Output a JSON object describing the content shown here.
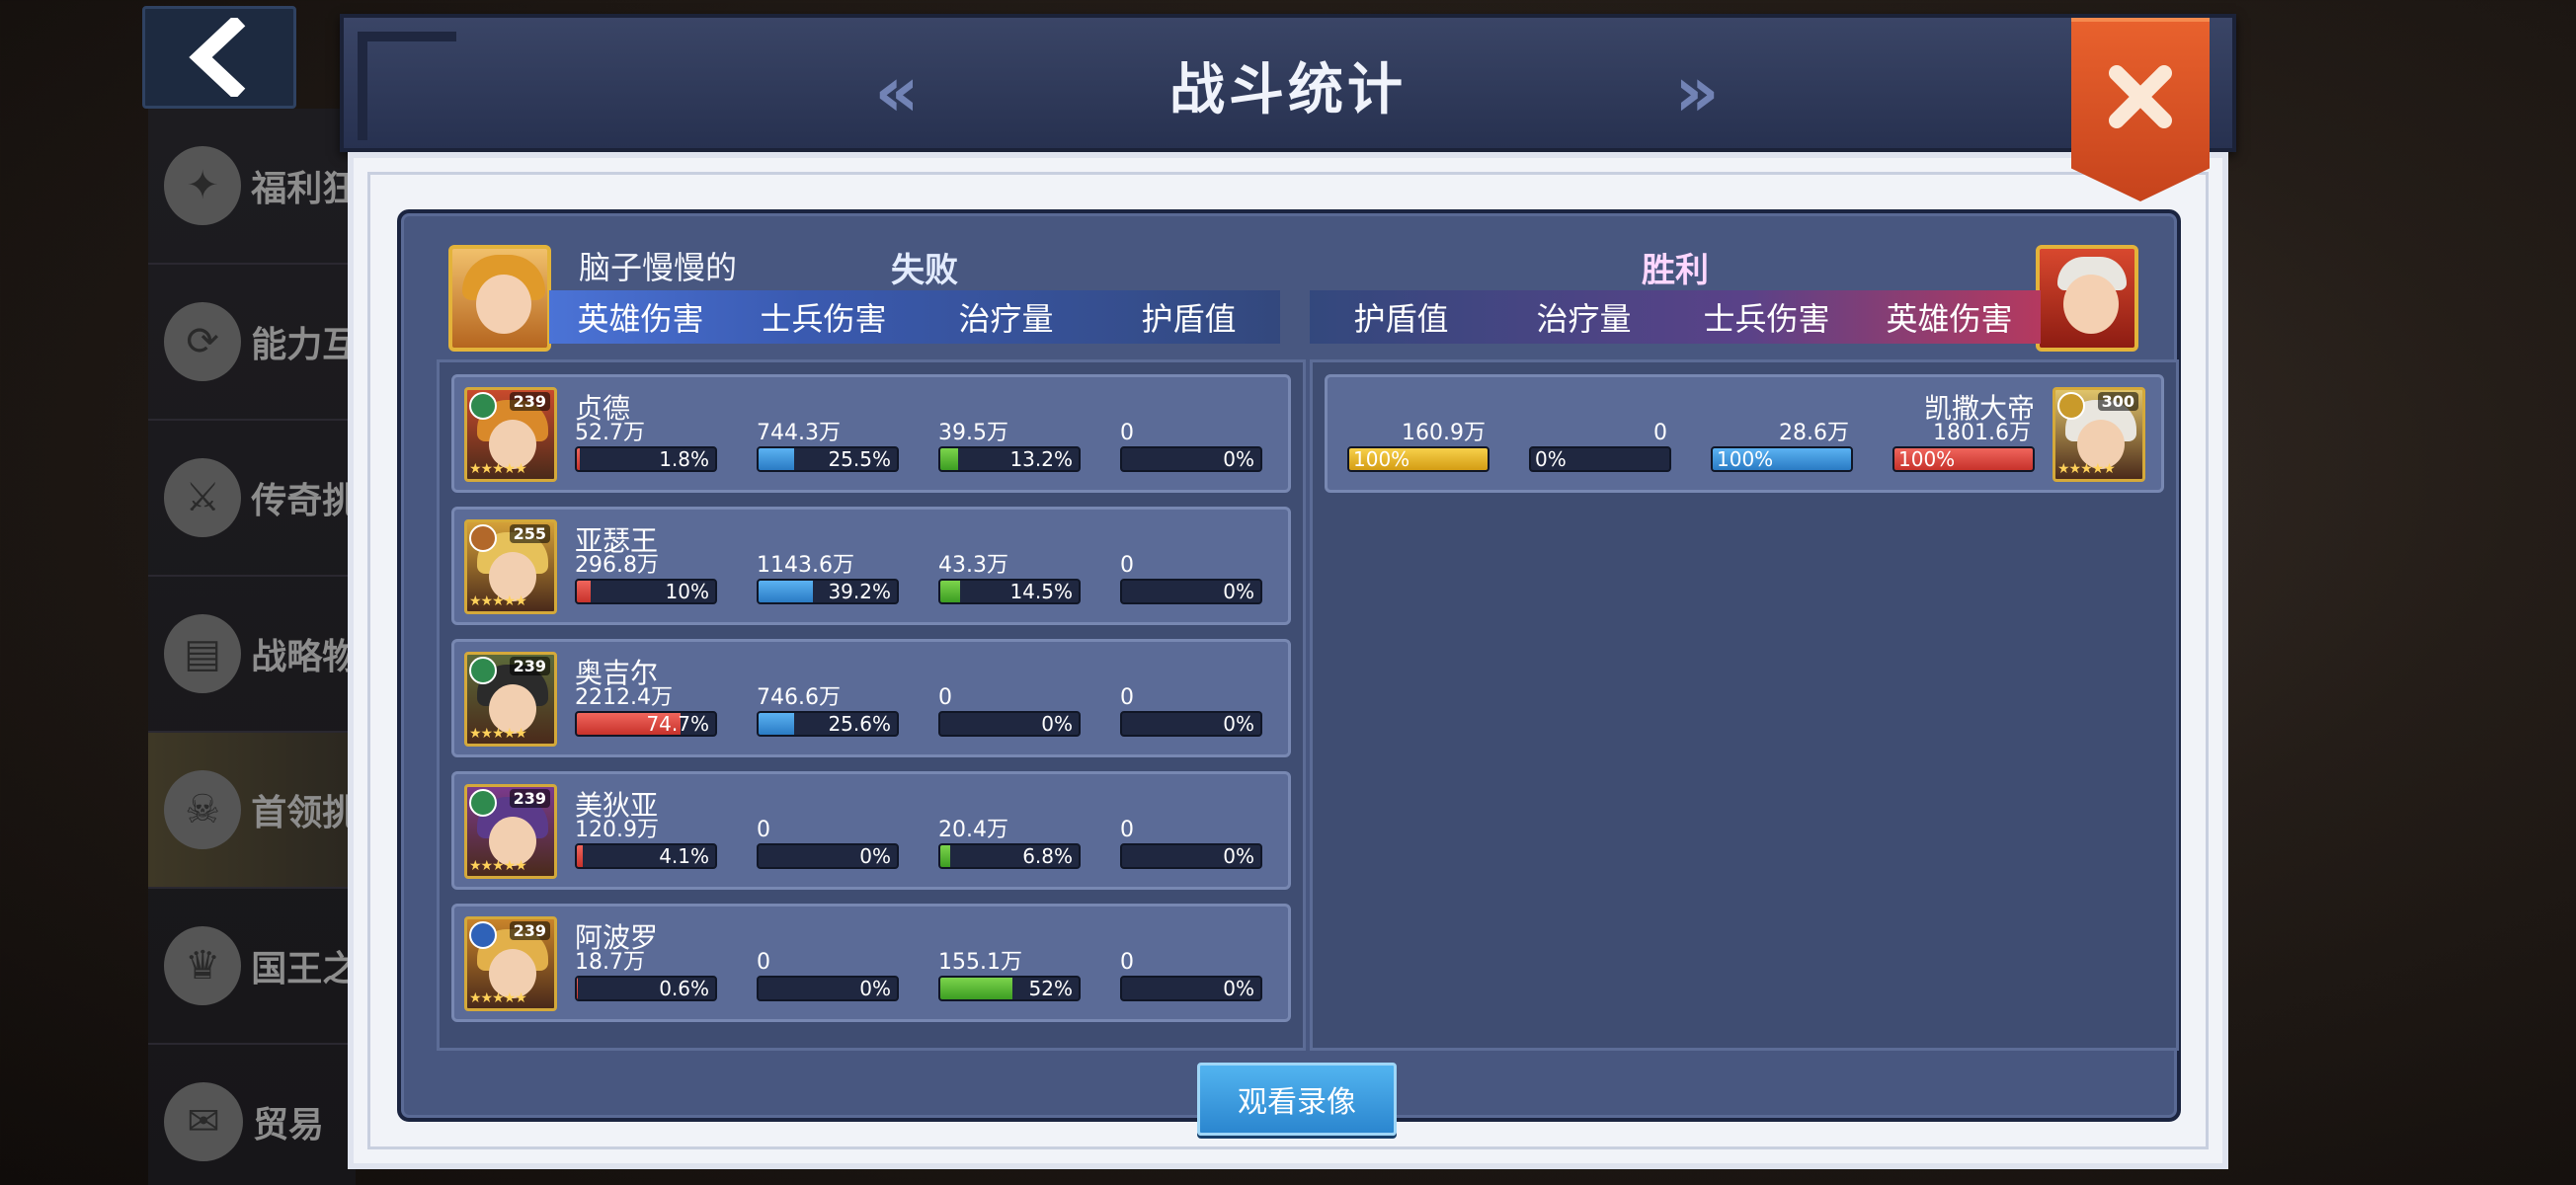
{
  "title": "战斗统计",
  "side_menu": [
    "福利狂",
    "能力互",
    "传奇挑",
    "战略物",
    "首领挑",
    "国王之",
    "贸易"
  ],
  "left_player": {
    "name": "脑子慢慢的",
    "result": "失败",
    "columns": [
      "英雄伤害",
      "士兵伤害",
      "治疗量",
      "护盾值"
    ],
    "heroes": [
      {
        "name": "贞德",
        "level": "239",
        "stats": [
          {
            "value": "52.7万",
            "pct": "1.8%",
            "fill": 0.018
          },
          {
            "value": "744.3万",
            "pct": "25.5%",
            "fill": 0.255
          },
          {
            "value": "39.5万",
            "pct": "13.2%",
            "fill": 0.132
          },
          {
            "value": "0",
            "pct": "0%",
            "fill": 0
          }
        ]
      },
      {
        "name": "亚瑟王",
        "level": "255",
        "stats": [
          {
            "value": "296.8万",
            "pct": "10%",
            "fill": 0.1
          },
          {
            "value": "1143.6万",
            "pct": "39.2%",
            "fill": 0.392
          },
          {
            "value": "43.3万",
            "pct": "14.5%",
            "fill": 0.145
          },
          {
            "value": "0",
            "pct": "0%",
            "fill": 0
          }
        ]
      },
      {
        "name": "奥吉尔",
        "level": "239",
        "stats": [
          {
            "value": "2212.4万",
            "pct": "74.7%",
            "fill": 0.747
          },
          {
            "value": "746.6万",
            "pct": "25.6%",
            "fill": 0.256
          },
          {
            "value": "0",
            "pct": "0%",
            "fill": 0
          },
          {
            "value": "0",
            "pct": "0%",
            "fill": 0
          }
        ]
      },
      {
        "name": "美狄亚",
        "level": "239",
        "stats": [
          {
            "value": "120.9万",
            "pct": "4.1%",
            "fill": 0.041
          },
          {
            "value": "0",
            "pct": "0%",
            "fill": 0
          },
          {
            "value": "20.4万",
            "pct": "6.8%",
            "fill": 0.068
          },
          {
            "value": "0",
            "pct": "0%",
            "fill": 0
          }
        ]
      },
      {
        "name": "阿波罗",
        "level": "239",
        "stats": [
          {
            "value": "18.7万",
            "pct": "0.6%",
            "fill": 0.006
          },
          {
            "value": "0",
            "pct": "0%",
            "fill": 0
          },
          {
            "value": "155.1万",
            "pct": "52%",
            "fill": 0.52
          },
          {
            "value": "0",
            "pct": "0%",
            "fill": 0
          }
        ]
      }
    ]
  },
  "right_player": {
    "result": "胜利",
    "columns": [
      "护盾值",
      "治疗量",
      "士兵伤害",
      "英雄伤害"
    ],
    "heroes": [
      {
        "name": "凯撒大帝",
        "level": "300",
        "stats": [
          {
            "value": "160.9万",
            "pct": "100%",
            "fill": 1.0
          },
          {
            "value": "0",
            "pct": "0%",
            "fill": 0
          },
          {
            "value": "28.6万",
            "pct": "100%",
            "fill": 1.0
          },
          {
            "value": "1801.6万",
            "pct": "100%",
            "fill": 1.0
          }
        ]
      }
    ]
  },
  "watch_button_label": "观看录像",
  "colors": {
    "hero_damage": "#e0433a",
    "soldier_damage": "#3b94dc",
    "healing": "#56b935",
    "shield": "#e7b526",
    "accent": "#e5582a"
  }
}
